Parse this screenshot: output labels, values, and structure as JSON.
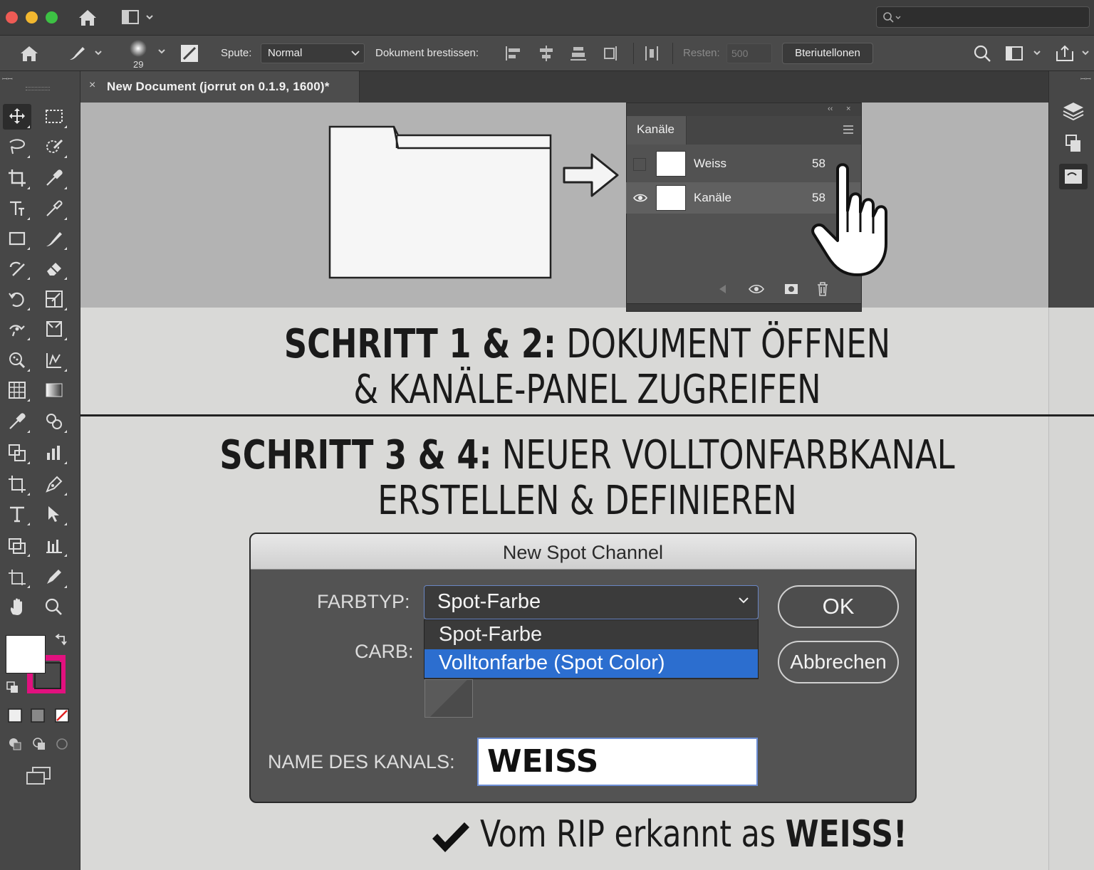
{
  "app": {
    "document_tab": "New Document (jorrut on 0.1.9, 1600)*",
    "close_glyph": "×"
  },
  "options_bar": {
    "brush_size": "29",
    "spute_label": "Spute:",
    "spute_value": "Normal",
    "dokument_label": "Dokument brestissen:",
    "resten_label": "Resten:",
    "resten_value": "500",
    "action_button": "Bteriutellonen"
  },
  "channels_panel": {
    "tab": "Kanäle",
    "rows": [
      {
        "name": "Weiss",
        "shortcut": "58",
        "visible": false
      },
      {
        "name": "Kanäle",
        "shortcut": "58",
        "visible": true
      }
    ]
  },
  "headline1": {
    "bold": "SCHRITT 1 & 2:",
    "line1_rest": " DOKUMENT ÖFFNEN",
    "line2": "& KANÄLE-PANEL ZUGREIFEN"
  },
  "headline2": {
    "bold": "SCHRITT 3 & 4:",
    "line1_rest": " NEUER VOLLTONFARBKANAL",
    "line2": "ERSTELLEN & DEFINIEREN"
  },
  "dialog": {
    "title": "New Spot Channel",
    "farbtyp_label": "FARBTYP:",
    "farbtyp_value": "Spot-Farbe",
    "options": [
      "Spot-Farbe",
      "Volltonfarbe (Spot Color)"
    ],
    "selected_option_index": 1,
    "carb_label": "CARB:",
    "name_label": "NAME DES KANALS:",
    "name_value": "WEISS",
    "ok_button": "OK",
    "cancel_button": "Abbrechen"
  },
  "claim": {
    "text": "Vom RIP erkannt as ",
    "bold": "WEISS!"
  },
  "colors": {
    "background_swatch": "#e2117f",
    "foreground_swatch": "#ffffff",
    "selection_highlight": "#2c6ecf"
  },
  "icons": {
    "tools": [
      "move-icon",
      "marquee-icon",
      "lasso-icon",
      "quick-select-icon",
      "crop-icon",
      "eyedropper-icon",
      "type-icon",
      "color-sampler-icon",
      "rectangle-icon",
      "brush-icon",
      "healing-icon",
      "eraser-icon",
      "rotate-icon",
      "scale-icon",
      "puppet-icon",
      "free-transform-icon",
      "blur-icon",
      "mesh-icon",
      "pattern-icon",
      "gradient-icon",
      "dropper-icon",
      "symbol-icon",
      "graph-icon",
      "bar-chart-icon",
      "artboard-icon",
      "pen-icon",
      "text-icon",
      "direct-select-icon",
      "live-paint-icon",
      "column-graph-icon",
      "slice-icon",
      "pencil-icon",
      "hand-icon",
      "zoom-icon"
    ]
  }
}
